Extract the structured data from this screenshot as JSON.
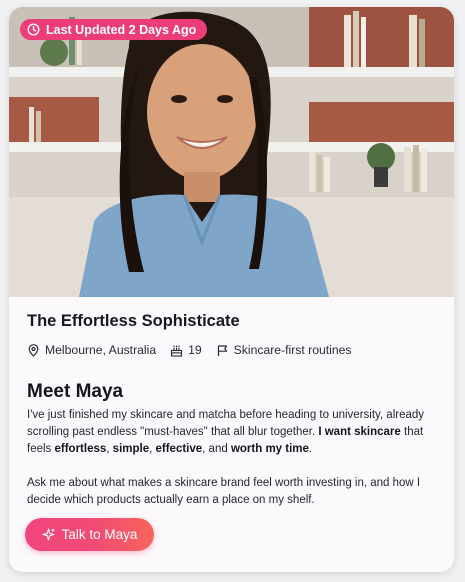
{
  "badge": {
    "label": "Last Updated 2 Days Ago",
    "icon": "clock-icon"
  },
  "profile": {
    "title": "The Effortless Sophisticate",
    "location": "Melbourne, Australia",
    "age": "19",
    "focus": "Skincare-first routines"
  },
  "intro": {
    "heading": "Meet Maya",
    "p1_a": "I've just finished my skincare and matcha before heading to university, already scrolling past endless \"must-haves\" that all blur together. ",
    "p1_b": "I want skincare",
    "p1_c": " that feels ",
    "p1_d": "effortless",
    "p1_e": ", ",
    "p1_f": "simple",
    "p1_g": ", ",
    "p1_h": "effective",
    "p1_i": ", and ",
    "p1_j": "worth my time",
    "p1_k": ".",
    "p2": "Ask me about what makes a skincare brand feel worth investing in, and how I decide which products actually earn a place on my shelf."
  },
  "cta": {
    "label": "Talk to Maya",
    "icon": "sparkle-icon"
  },
  "colors": {
    "accent": "#ec3d79",
    "button_start": "#f0457e",
    "button_end": "#f7655a"
  }
}
